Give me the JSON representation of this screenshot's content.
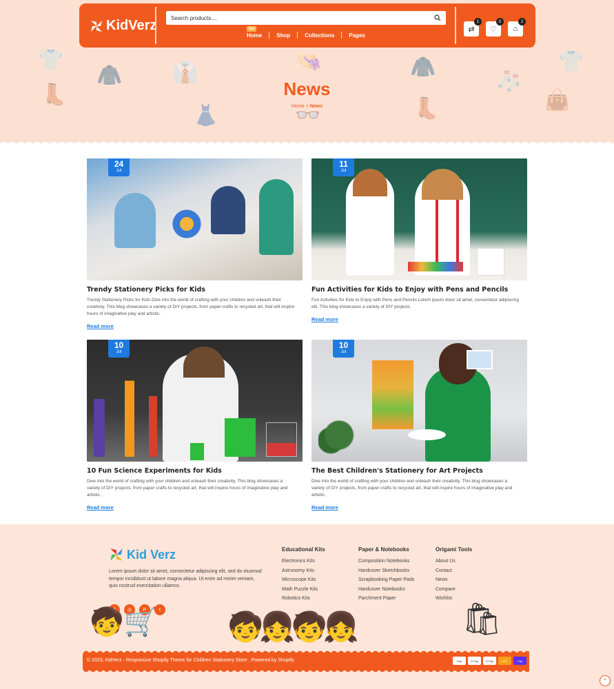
{
  "brand": {
    "logo_text": "KidVerz",
    "footer_logo_text": "Kid Verz",
    "accent": "#f15a1f",
    "link_color": "#1f7ae0"
  },
  "header": {
    "search_placeholder": "Search products....",
    "nav": [
      {
        "label": "Home",
        "badge": "Hot"
      },
      {
        "label": "Shop"
      },
      {
        "label": "Collections"
      },
      {
        "label": "Pages"
      }
    ],
    "icons": [
      {
        "name": "compare-icon",
        "count": "1"
      },
      {
        "name": "wishlist-icon",
        "count": "0"
      },
      {
        "name": "cart-icon",
        "count": "2"
      }
    ]
  },
  "hero": {
    "title": "News",
    "breadcrumb_home": "Home",
    "breadcrumb_sep": ">",
    "breadcrumb_current": "News"
  },
  "posts": [
    {
      "day": "24",
      "month": "Jul",
      "title": "Trendy Stationery Picks for Kids",
      "excerpt": "Trendy Stationery Picks for Kids Dive into the world of crafting with your children and unleash their creativity. This blog showcases a variety of DIY projects, from paper crafts to recycled art, that will inspire hours of imaginative play and artistic.",
      "read_more": "Read more"
    },
    {
      "day": "11",
      "month": "Jul",
      "title": "Fun Activities for Kids to Enjoy with Pens and Pencils",
      "excerpt": "Fun Activities for Kids to Enjoy with Pens and Pencils Lorem ipsum dolor sit amet, consectetur adipiscing elit. This blog showcases a variety of DIY projects",
      "read_more": "Read more"
    },
    {
      "day": "10",
      "month": "Jul",
      "title": "10 Fun Science Experiments for Kids",
      "excerpt": "Dive into the world of crafting with your children and unleash their creativity. This blog showcases a variety of DIY projects, from paper crafts to recycled art, that will inspire hours of imaginative play and artistic.",
      "read_more": "Read more"
    },
    {
      "day": "10",
      "month": "Jul",
      "title": "The Best Children's Stationery for Art Projects",
      "excerpt": "Dive into the world of crafting with your children and unleash their creativity. This blog showcases a variety of DIY projects, from paper crafts to recycled art, that will inspire hours of imaginative play and artistic.",
      "read_more": "Read more"
    }
  ],
  "footer": {
    "about": "Lorem ipsum dolor sit amet, consectetur adipiscing elit, sed do eiusmod tempor incididunt ut labore magna aliqua. Ut enim ad minim veniam, quis nostrud exercitation ullamco.",
    "columns": [
      {
        "title": "Educational Kits",
        "links": [
          "Electronics Kits",
          "Astronomy Kits",
          "Microscope Kits",
          "Math Puzzle Kits",
          "Robotics Kits"
        ]
      },
      {
        "title": "Paper & Notebooks",
        "links": [
          "Composition Notebooks",
          "Hardcover Sketchbooks",
          "Scrapbooking Paper Pads",
          "Hardcover Notebooks",
          "Parchment Paper"
        ]
      },
      {
        "title": "Origami Tools",
        "links": [
          "About Us",
          "Contact",
          "News",
          "Compare",
          "Wishlist"
        ]
      }
    ],
    "copyright": "© 2023, KidVerz - Responsive Shopify Theme for Children Stationery Store . Powered by Shopify",
    "payments": [
      "Pay",
      "G Pay",
      "G Pay",
      "MC",
      "Pay"
    ]
  }
}
